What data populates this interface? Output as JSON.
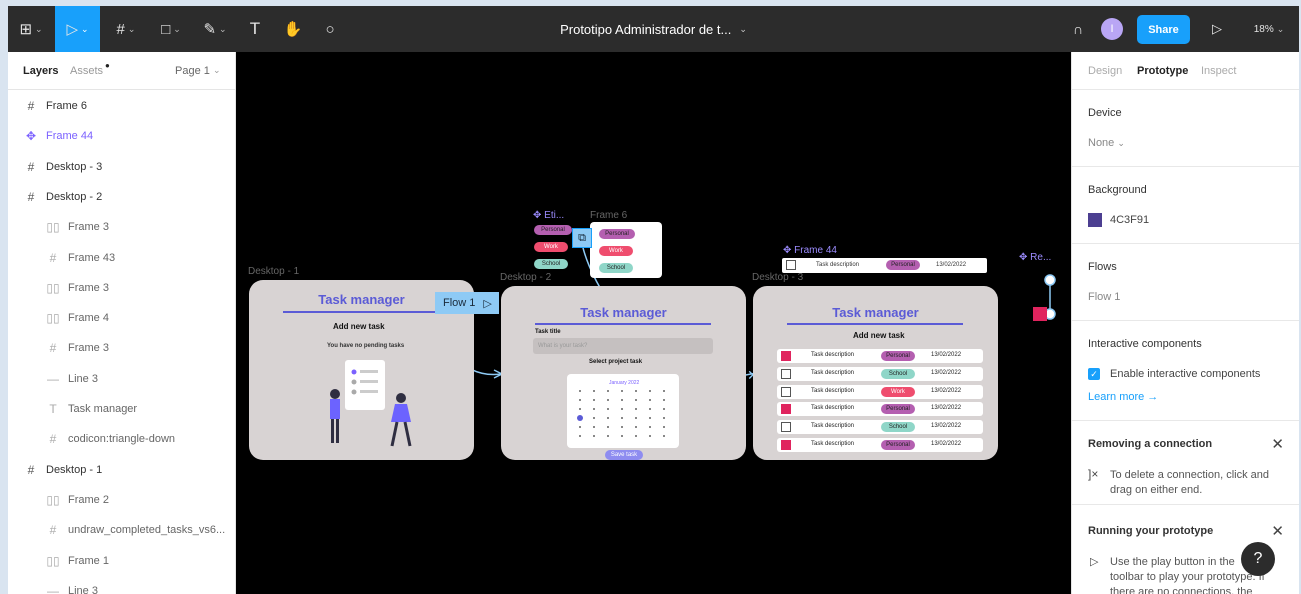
{
  "toolbar": {
    "doc_title": "Prototipo Administrador de t...",
    "avatar_initial": "I",
    "share_label": "Share",
    "zoom": "18%"
  },
  "left_panel": {
    "tabs": [
      "Layers",
      "Assets",
      "Page 1"
    ],
    "layers": [
      {
        "name": "Frame 6",
        "kind": "frame"
      },
      {
        "name": "Frame 44",
        "kind": "component"
      },
      {
        "name": "Desktop - 3",
        "kind": "frame"
      },
      {
        "name": "Desktop - 2",
        "kind": "frame"
      },
      {
        "name": "Frame 3",
        "kind": "autolayout"
      },
      {
        "name": "Frame 43",
        "kind": "frame-child"
      },
      {
        "name": "Frame 3",
        "kind": "autolayout"
      },
      {
        "name": "Frame 4",
        "kind": "autolayout"
      },
      {
        "name": "Frame 3",
        "kind": "frame-child"
      },
      {
        "name": "Line 3",
        "kind": "line"
      },
      {
        "name": "Task manager",
        "kind": "text"
      },
      {
        "name": "codicon:triangle-down",
        "kind": "frame-child"
      },
      {
        "name": "Desktop - 1",
        "kind": "frame"
      },
      {
        "name": "Frame 2",
        "kind": "autolayout"
      },
      {
        "name": "undraw_completed_tasks_vs6...",
        "kind": "frame-child"
      },
      {
        "name": "Frame 1",
        "kind": "autolayout"
      },
      {
        "name": "Line 3",
        "kind": "line"
      }
    ]
  },
  "canvas": {
    "frame_labels": {
      "desktop1": "Desktop - 1",
      "desktop2": "Desktop - 2",
      "desktop3": "Desktop - 3",
      "etiq": "Eti...",
      "frame6": "Frame 6",
      "frame44": "Frame 44",
      "re": "Re..."
    },
    "flow_badge": "Flow 1",
    "app_title": "Task manager",
    "add_new_task": "Add new task",
    "no_pending": "You have no pending tasks",
    "task_title_label": "Task title",
    "task_title_placeholder": "What is your task?",
    "select_project": "Select project task",
    "calendar_month": "January 2022",
    "save_task": "Save task",
    "tags": [
      "Personal",
      "Work",
      "School"
    ],
    "frame44_row": {
      "desc": "Task description",
      "tag": "Personal",
      "date": "13/02/2022"
    },
    "rows": [
      {
        "desc": "Task description",
        "tag": "Personal",
        "date": "13/02/2022",
        "checked": true
      },
      {
        "desc": "Task description",
        "tag": "School",
        "date": "13/02/2022",
        "checked": false
      },
      {
        "desc": "Task description",
        "tag": "Work",
        "date": "13/02/2022",
        "checked": false
      },
      {
        "desc": "Task description",
        "tag": "Personal",
        "date": "13/02/2022",
        "checked": true
      },
      {
        "desc": "Task description",
        "tag": "School",
        "date": "13/02/2022",
        "checked": false
      },
      {
        "desc": "Task description",
        "tag": "Personal",
        "date": "13/02/2022",
        "checked": true
      }
    ]
  },
  "right_panel": {
    "tabs": [
      "Design",
      "Prototype",
      "Inspect"
    ],
    "device_label": "Device",
    "device_value": "None",
    "background_label": "Background",
    "background_hex": "4C3F91",
    "flows_label": "Flows",
    "flow_item": "Flow 1",
    "interactive_label": "Interactive components",
    "enable_interactive": "Enable interactive components",
    "learn_more": "Learn more →",
    "removing_title": "Removing a connection",
    "removing_text": "To delete a connection, click and drag on either end.",
    "running_title": "Running your prototype",
    "running_text": "Use the play button in the toolbar to play your prototype. If there are no connections, the"
  },
  "colors": {
    "toolbar_bg": "#2c2c2c",
    "accent": "#18a0fb",
    "component": "#7b61ff",
    "brand_purple": "#5b5bd6",
    "swatch": "#4C3F91"
  }
}
